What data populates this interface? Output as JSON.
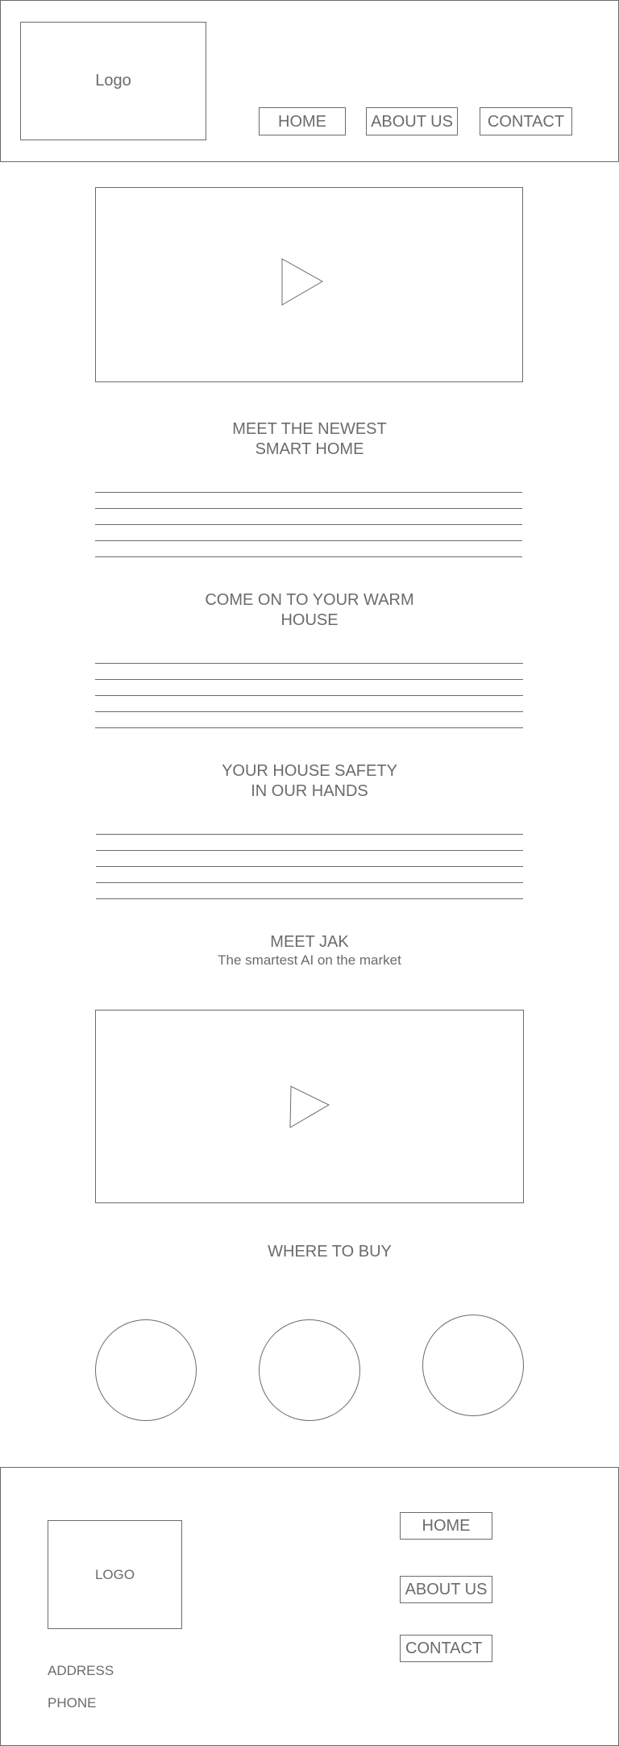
{
  "header": {
    "logo_label": "Logo",
    "nav": {
      "home": "HOME",
      "about": "ABOUT US",
      "contact": "CONTACT"
    }
  },
  "hero_video": {
    "icon": "play-icon"
  },
  "sections": [
    {
      "title_line1": "MEET THE NEWEST",
      "title_line2": "SMART HOME"
    },
    {
      "title_line1": "COME ON TO YOUR WARM",
      "title_line2": "HOUSE"
    },
    {
      "title_line1": "YOUR HOUSE SAFETY",
      "title_line2": "IN OUR HANDS"
    }
  ],
  "meet_jak": {
    "title": "MEET JAK",
    "subtitle": "The smartest AI on the market"
  },
  "jak_video": {
    "icon": "play-icon"
  },
  "where_to_buy": {
    "title": "WHERE TO BUY"
  },
  "footer": {
    "logo_label": "LOGO",
    "address_label": "ADDRESS",
    "phone_label": "PHONE",
    "nav": {
      "home": "HOME",
      "about": "ABOUT US",
      "contact": "CONTACT"
    }
  }
}
